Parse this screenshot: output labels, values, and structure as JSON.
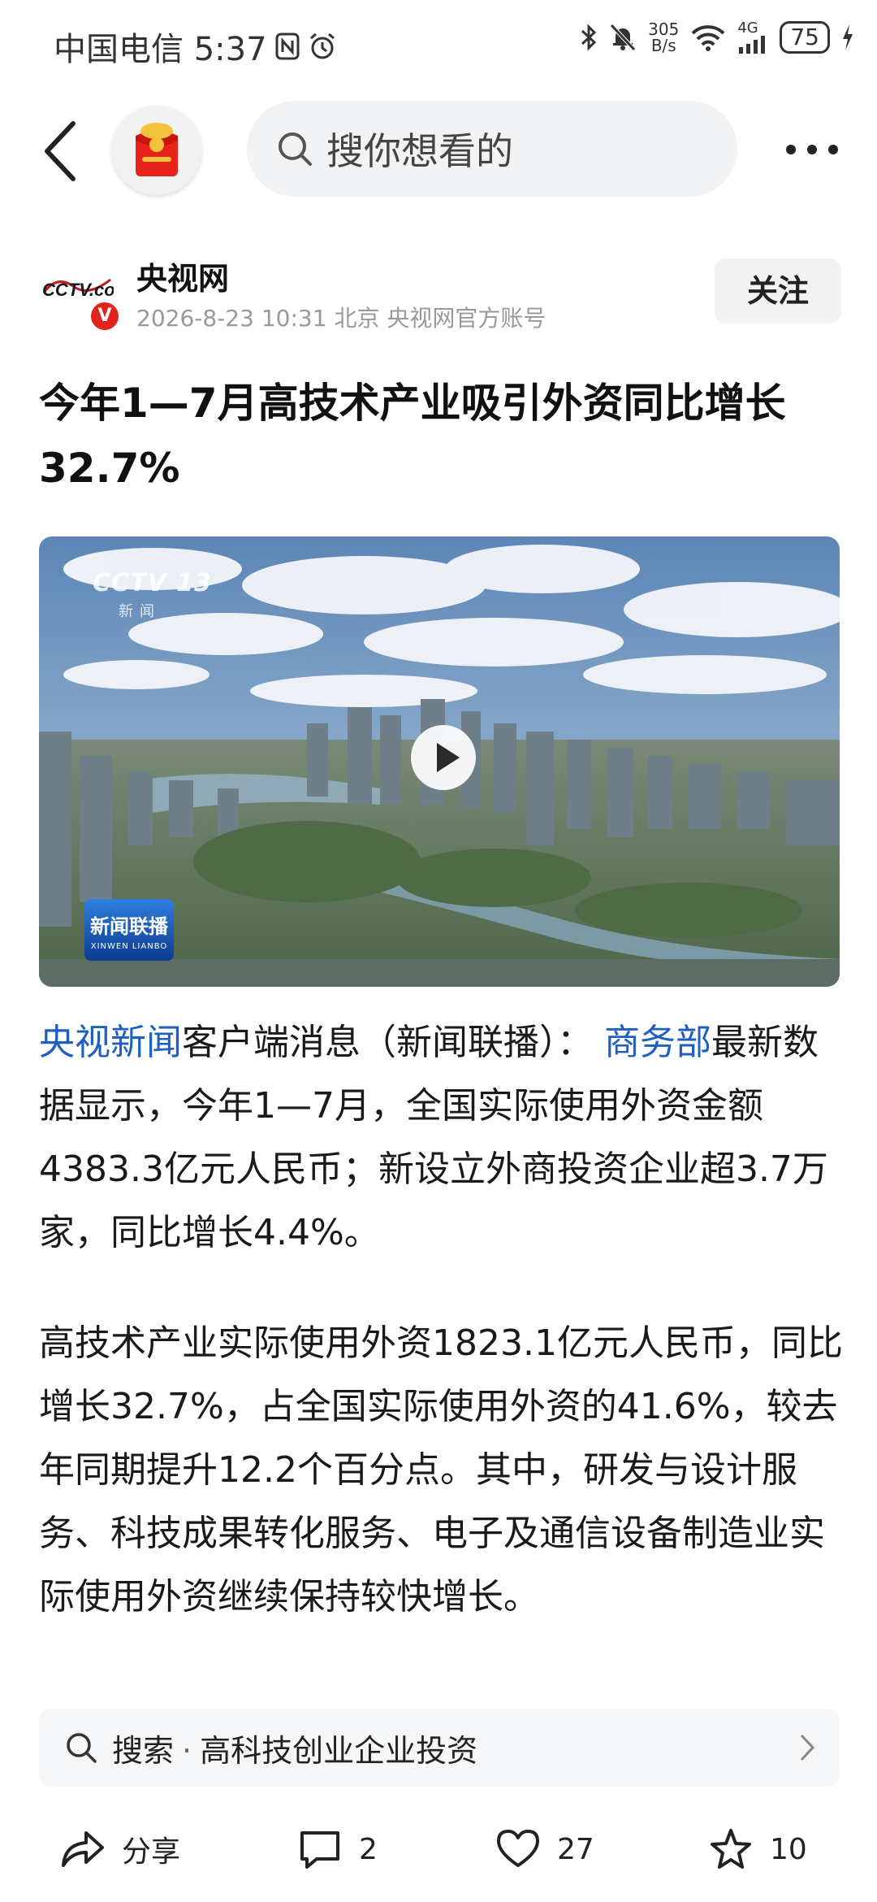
{
  "status_bar": {
    "carrier_time": "中国电信 5:37",
    "network_speed_value": "305",
    "network_speed_unit": "B/s",
    "network_type": "4G",
    "battery": "75"
  },
  "nav": {
    "search_placeholder": "搜你想看的"
  },
  "author": {
    "name": "央视网",
    "date": "2026-8-23",
    "time": "10:31",
    "location": "北京",
    "account_type": "央视网官方账号",
    "follow_label": "关注",
    "logo_text": "CCTV.com"
  },
  "article": {
    "title": "今年1—7月高技术产业吸引外资同比增长32.7%",
    "video": {
      "channel_mark": "CCTV 13",
      "channel_sub": "新闻",
      "program_badge": "新闻联播",
      "program_badge_pinyin": "XINWEN LIANBO"
    },
    "p1_link1": "央视新闻",
    "p1_text1": "客户端消息（新闻联播）：",
    "p1_link2": "商务部",
    "p1_text2": "最新数据显示，今年1—7月，全国实际使用外资金额4383.3亿元人民币；新设立外商投资企业超3.7万家，同比增长4.4%。",
    "p2": "高技术产业实际使用外资1823.1亿元人民币，同比增长32.7%，占全国实际使用外资的41.6%，较去年同期提升12.2个百分点。其中，研发与设计服务、科技成果转化服务、电子及通信设备制造业实际使用外资继续保持较快增长。"
  },
  "related_search": {
    "prefix": "搜索",
    "separator": "·",
    "query": "高科技创业企业投资"
  },
  "actions": {
    "share_label": "分享",
    "comment_count": "2",
    "like_count": "27",
    "favorite_count": "10"
  }
}
